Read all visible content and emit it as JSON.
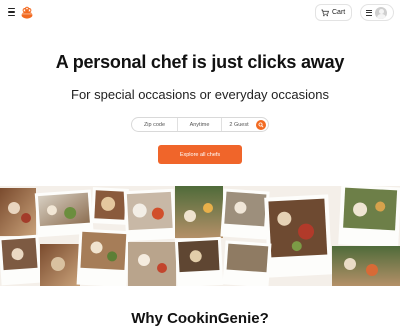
{
  "header": {
    "menu_icon": "hamburger-icon",
    "logo_icon": "chef-pot-logo-icon",
    "cart_label": "Cart",
    "cart_icon": "cart-icon",
    "user_menu_icon": "hamburger-icon",
    "avatar_icon": "user-avatar-icon"
  },
  "hero": {
    "title": "A personal chef is just clicks away",
    "subtitle": "For special occasions or everyday occasions"
  },
  "search": {
    "zip_placeholder": "Zip code",
    "time_placeholder": "Anytime",
    "guests_value": "2 Guest",
    "search_icon": "search-icon",
    "accent_color": "#f26a21"
  },
  "cta": {
    "label": "Explore all chefs",
    "color": "#f0652a"
  },
  "collage": {
    "photo_count": 16
  },
  "section": {
    "why_title": "Why CookinGenie?"
  }
}
